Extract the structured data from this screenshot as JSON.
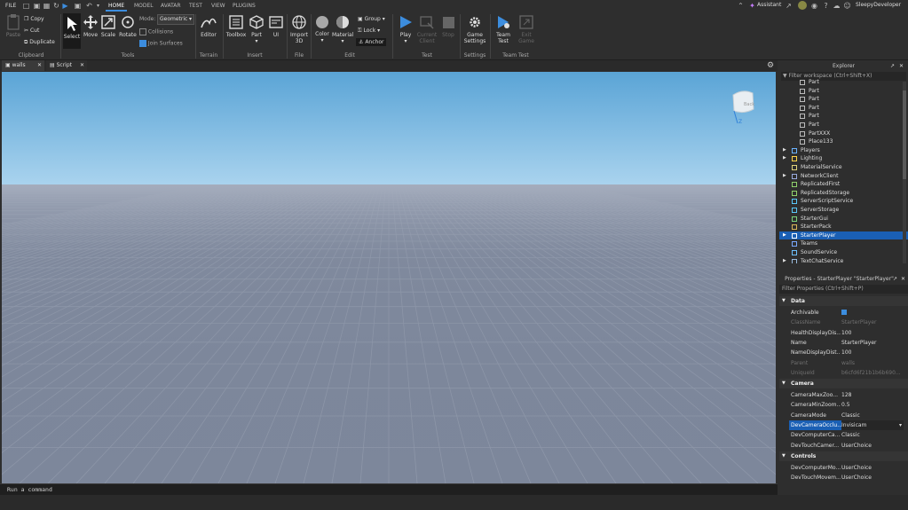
{
  "menubar": {
    "file": "FILE",
    "tabs": [
      "HOME",
      "MODEL",
      "AVATAR",
      "TEST",
      "VIEW",
      "PLUGINS"
    ],
    "active_tab": "HOME",
    "assistant": "Assistant",
    "username": "SleepyDeveloper"
  },
  "ribbon": {
    "clipboard": {
      "paste": "Paste",
      "copy": "Copy",
      "cut": "Cut",
      "duplicate": "Duplicate",
      "label": "Clipboard"
    },
    "tools": {
      "select": "Select",
      "move": "Move",
      "scale": "Scale",
      "rotate": "Rotate",
      "mode_label": "Mode:",
      "mode_value": "Geometric",
      "collisions": "Collisions",
      "join_surfaces": "Join Surfaces",
      "label": "Tools"
    },
    "terrain": {
      "editor": "Editor",
      "label": "Terrain"
    },
    "insert": {
      "toolbox": "Toolbox",
      "part": "Part",
      "ui": "UI",
      "label": "Insert"
    },
    "file": {
      "import3d_1": "Import",
      "import3d_2": "3D",
      "label": "File"
    },
    "edit": {
      "color": "Color",
      "material": "Material",
      "group": "Group",
      "lock": "Lock",
      "anchor": "Anchor",
      "label": "Edit"
    },
    "test": {
      "play": "Play",
      "current_client_1": "Current",
      "current_client_2": "Client",
      "stop": "Stop",
      "label": "Test"
    },
    "settings": {
      "game_1": "Game",
      "game_2": "Settings",
      "label": "Settings"
    },
    "teamtest": {
      "team_1": "Team",
      "team_2": "Test",
      "exit_1": "Exit",
      "exit_2": "Game",
      "label": "Team Test"
    }
  },
  "doctabs": [
    {
      "label": "walls"
    },
    {
      "label": "Script"
    }
  ],
  "viewcube": {
    "face": "Back",
    "axis": "Z"
  },
  "explorer": {
    "title": "Explorer",
    "filter": "Filter workspace (Ctrl+Shift+X)",
    "items": [
      {
        "label": "Part",
        "indent": 2,
        "icon": "part"
      },
      {
        "label": "Part",
        "indent": 2,
        "icon": "part"
      },
      {
        "label": "Part",
        "indent": 2,
        "icon": "part"
      },
      {
        "label": "Part",
        "indent": 2,
        "icon": "part"
      },
      {
        "label": "Part",
        "indent": 2,
        "icon": "part"
      },
      {
        "label": "Part",
        "indent": 2,
        "icon": "part"
      },
      {
        "label": "PartXXX",
        "indent": 2,
        "icon": "part"
      },
      {
        "label": "Place133",
        "indent": 2,
        "icon": "part"
      },
      {
        "label": "Players",
        "indent": 1,
        "icon": "players",
        "arrow": true
      },
      {
        "label": "Lighting",
        "indent": 1,
        "icon": "lighting",
        "arrow": true
      },
      {
        "label": "MaterialService",
        "indent": 1,
        "icon": "material"
      },
      {
        "label": "NetworkClient",
        "indent": 1,
        "icon": "network",
        "arrow": true
      },
      {
        "label": "ReplicatedFirst",
        "indent": 1,
        "icon": "replicated"
      },
      {
        "label": "ReplicatedStorage",
        "indent": 1,
        "icon": "replicated"
      },
      {
        "label": "ServerScriptService",
        "indent": 1,
        "icon": "script"
      },
      {
        "label": "ServerStorage",
        "indent": 1,
        "icon": "storage"
      },
      {
        "label": "StarterGui",
        "indent": 1,
        "icon": "gui"
      },
      {
        "label": "StarterPack",
        "indent": 1,
        "icon": "pack"
      },
      {
        "label": "StarterPlayer",
        "indent": 1,
        "icon": "player",
        "arrow": true,
        "selected": true
      },
      {
        "label": "Teams",
        "indent": 1,
        "icon": "teams"
      },
      {
        "label": "SoundService",
        "indent": 1,
        "icon": "sound"
      },
      {
        "label": "TextChatService",
        "indent": 1,
        "icon": "chat",
        "arrow": true
      }
    ]
  },
  "properties": {
    "title": "Properties - StarterPlayer \"StarterPlayer\"",
    "filter": "Filter Properties (Ctrl+Shift+P)",
    "sections": [
      {
        "name": "Data",
        "rows": [
          {
            "name": "Archivable",
            "value": "",
            "checkbox": true
          },
          {
            "name": "ClassName",
            "value": "StarterPlayer",
            "dim": true
          },
          {
            "name": "HealthDisplayDis...",
            "value": "100"
          },
          {
            "name": "Name",
            "value": "StarterPlayer"
          },
          {
            "name": "NameDisplayDist...",
            "value": "100"
          },
          {
            "name": "Parent",
            "value": "walls",
            "dim": true
          },
          {
            "name": "UniqueId",
            "value": "b6cfd6f21b1b6b690...",
            "dim": true
          }
        ]
      },
      {
        "name": "Camera",
        "rows": [
          {
            "name": "CameraMaxZoo...",
            "value": "128"
          },
          {
            "name": "CameraMinZoom...",
            "value": "0.5"
          },
          {
            "name": "CameraMode",
            "value": "Classic"
          },
          {
            "name": "DevCameraOcclu...",
            "value": "Invisicam",
            "selected": true
          },
          {
            "name": "DevComputerCa...",
            "value": "Classic"
          },
          {
            "name": "DevTouchCamer...",
            "value": "UserChoice"
          }
        ]
      },
      {
        "name": "Controls",
        "rows": [
          {
            "name": "DevComputerMo...",
            "value": "UserChoice"
          },
          {
            "name": "DevTouchMovem...",
            "value": "UserChoice"
          }
        ]
      }
    ]
  },
  "command": {
    "placeholder": "Run a command"
  }
}
